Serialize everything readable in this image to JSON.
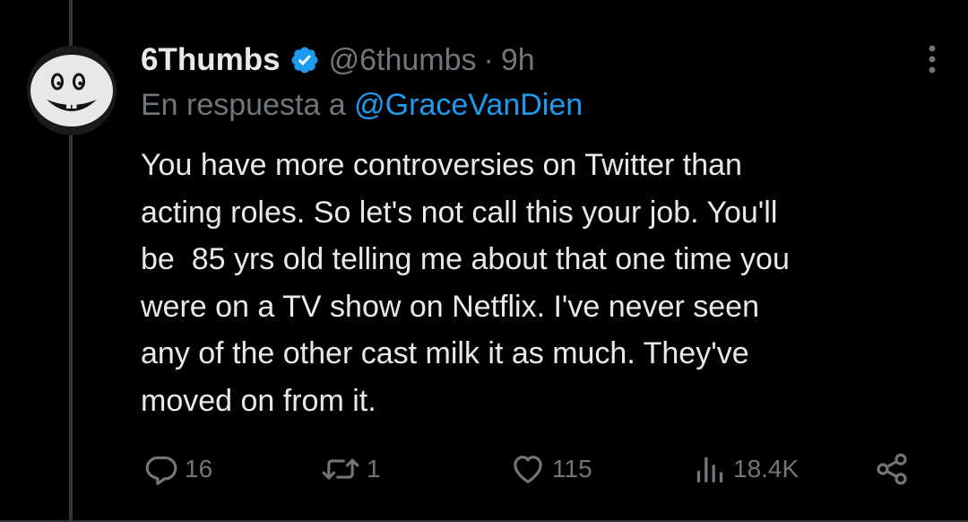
{
  "tweet": {
    "display_name": "6Thumbs",
    "handle": "@6thumbs",
    "separator": "·",
    "time": "9h",
    "verified": true,
    "reply_prefix": "En respuesta a",
    "reply_to": "@GraceVanDien",
    "text_lines": [
      "You have more controversies on Twitter than",
      "acting roles. So let's not call this your job. You'll",
      "be  85 yrs old telling me about that one time you",
      "were on a TV show on Netflix. I've never seen",
      "any of the other cast milk it as much. They've",
      "moved on from it."
    ]
  },
  "actions": {
    "replies": "16",
    "retweets": "1",
    "likes": "115",
    "views": "18.4K"
  },
  "icons": {
    "avatar": "smiley-face-avatar",
    "verified": "verified-badge-icon",
    "more": "more-options-icon",
    "reply": "reply-icon",
    "retweet": "retweet-icon",
    "like": "heart-icon",
    "views": "views-icon",
    "share": "share-icon"
  },
  "colors": {
    "background": "#000000",
    "text": "#e7e9ea",
    "secondary": "#71767b",
    "link": "#1d9bf0",
    "verified": "#1d9bf0"
  }
}
